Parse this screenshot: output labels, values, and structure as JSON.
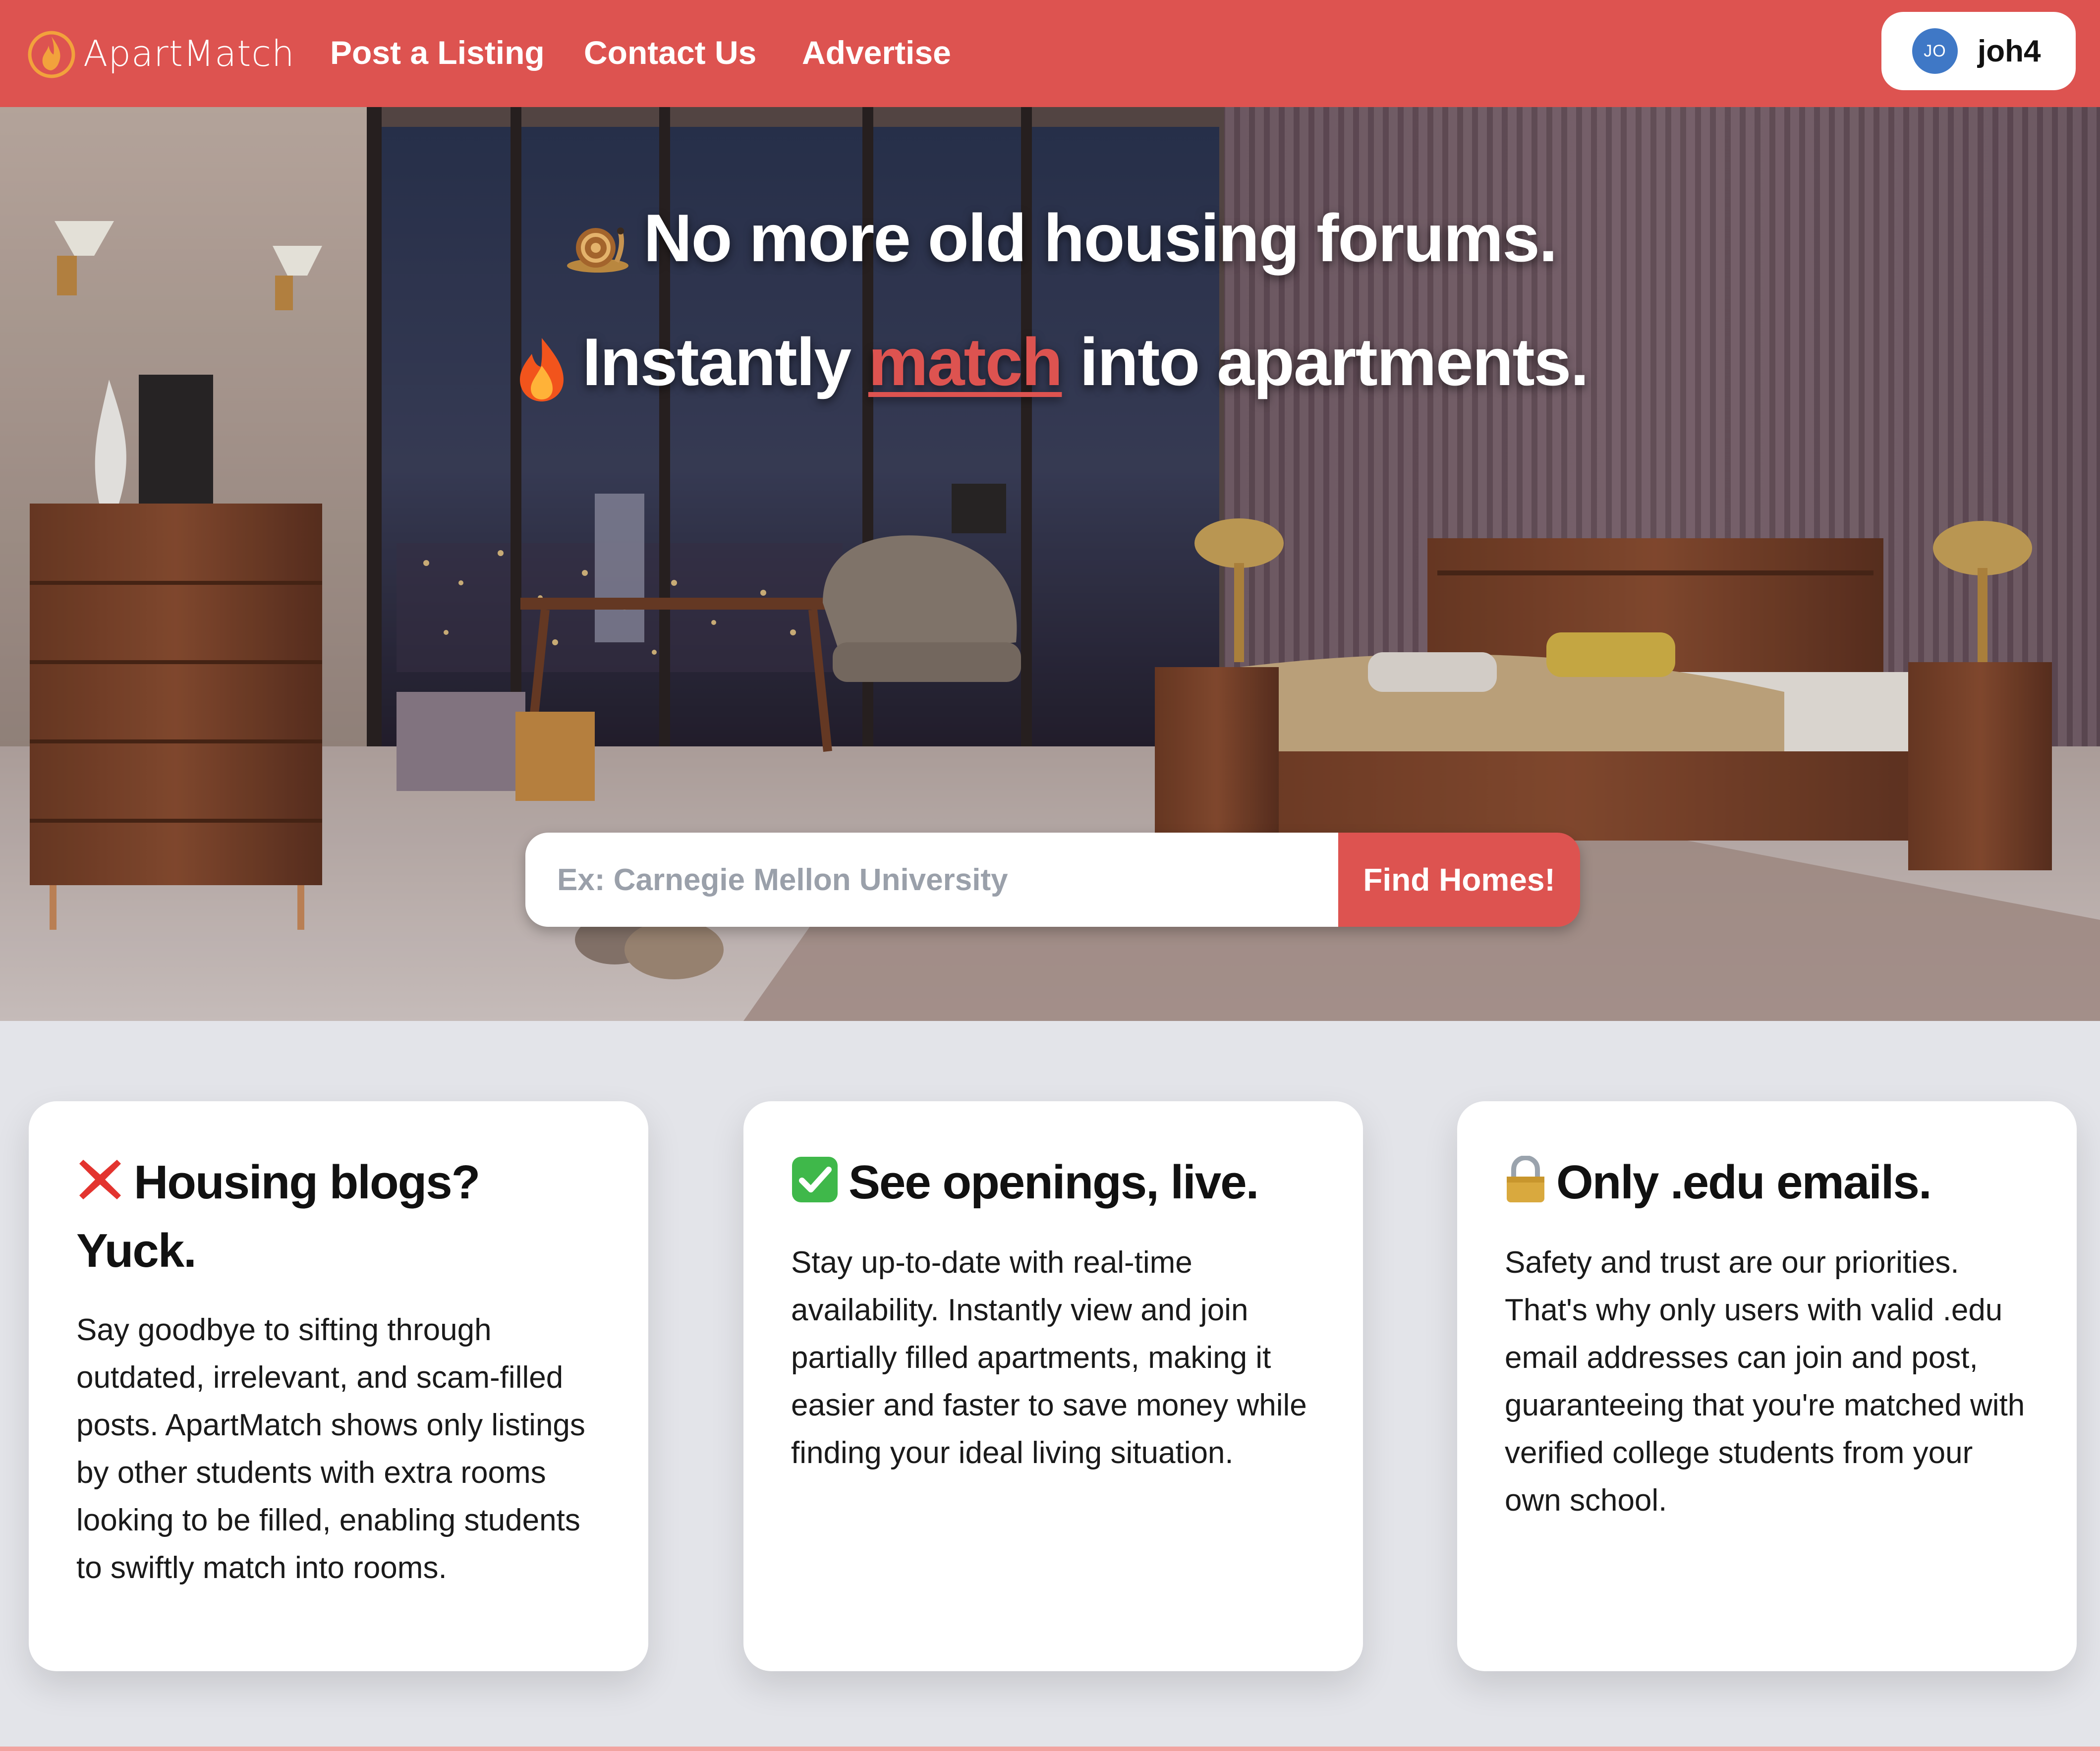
{
  "nav": {
    "brand": "ApartMatch",
    "links": [
      "Post a Listing",
      "Contact Us",
      "Advertise"
    ],
    "user": {
      "initials": "JO",
      "name": "joh4"
    }
  },
  "hero": {
    "line1": {
      "emoji": "snail-icon",
      "text": "No more old housing forums."
    },
    "line2": {
      "emoji": "fire-icon",
      "before": "Instantly ",
      "highlight": "match",
      "after": " into apartments."
    },
    "search": {
      "placeholder": "Ex: Carnegie Mellon University",
      "button": "Find Homes!"
    }
  },
  "cards": [
    {
      "icon": "red-x-icon",
      "title": "Housing blogs? Yuck.",
      "body": "Say goodbye to sifting through outdated, irrelevant, and scam-filled posts. ApartMatch shows only listings by other students with extra rooms looking to be filled, enabling students to swiftly match into rooms."
    },
    {
      "icon": "check-mark-icon",
      "title": "See openings, live.",
      "body": "Stay up-to-date with real-time availability. Instantly view and join partially filled apartments, making it easier and faster to save money while finding your ideal living situation."
    },
    {
      "icon": "padlock-icon",
      "title": "Only .edu emails.",
      "body": "Safety and trust are our priorities. That's why only users with valid .edu email addresses can join and post, guaranteeing that you're matched with verified college students from your own school."
    }
  ],
  "colors": {
    "brand": "#dd5350",
    "page_bg": "#e3e4e9",
    "avatar": "#3f78c6"
  }
}
